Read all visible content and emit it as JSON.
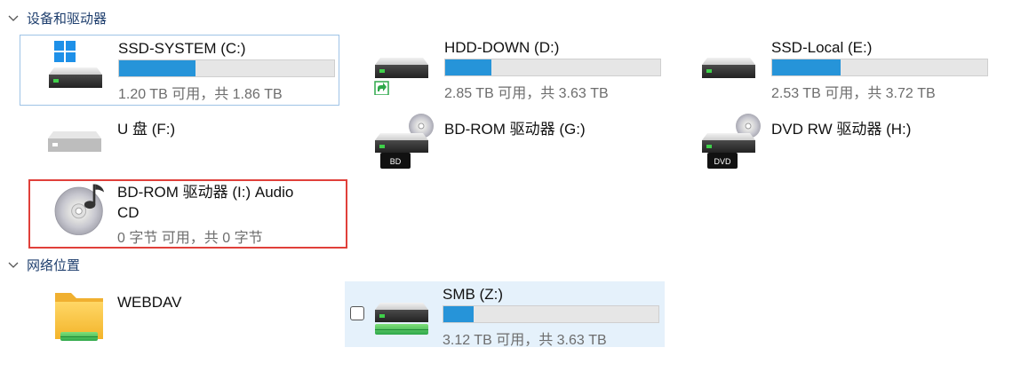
{
  "sections": {
    "devices": {
      "label": "设备和驱动器"
    },
    "network": {
      "label": "网络位置"
    }
  },
  "drives": [
    {
      "name": "SSD-SYSTEM (C:)",
      "info": "1.20 TB 可用，共 1.86 TB",
      "used_fraction": 0.355
    },
    {
      "name": "HDD-DOWN (D:)",
      "info": "2.85 TB 可用，共 3.63 TB",
      "used_fraction": 0.215
    },
    {
      "name": "SSD-Local (E:)",
      "info": "2.53 TB 可用，共 3.72 TB",
      "used_fraction": 0.32
    },
    {
      "name": "U 盘 (F:)"
    },
    {
      "name": "BD-ROM 驱动器 (G:)",
      "badge": "BD"
    },
    {
      "name": "DVD RW 驱动器 (H:)",
      "badge": "DVD"
    },
    {
      "name_line1": "BD-ROM 驱动器 (I:) Audio",
      "name_line2": "CD",
      "info": "0 字节 可用，共 0 字节"
    }
  ],
  "network": [
    {
      "name": "WEBDAV"
    },
    {
      "name": "SMB (Z:)",
      "info": "3.12 TB 可用，共 3.63 TB",
      "used_fraction": 0.14
    }
  ],
  "colors": {
    "bar_fill": "#2694d9",
    "bar_track": "#e6e6e6",
    "section_text": "#1f3f6e",
    "highlight_box": "#e0403a",
    "hover_bg": "#e5f1fb"
  },
  "icons": {
    "hdd": "hard-drive-icon",
    "windows": "windows-logo-icon",
    "shortcut": "shortcut-arrow-icon",
    "optical": "optical-drive-icon",
    "disc": "disc-icon",
    "music": "music-note-icon",
    "folder": "folder-icon",
    "network": "network-drive-icon"
  }
}
